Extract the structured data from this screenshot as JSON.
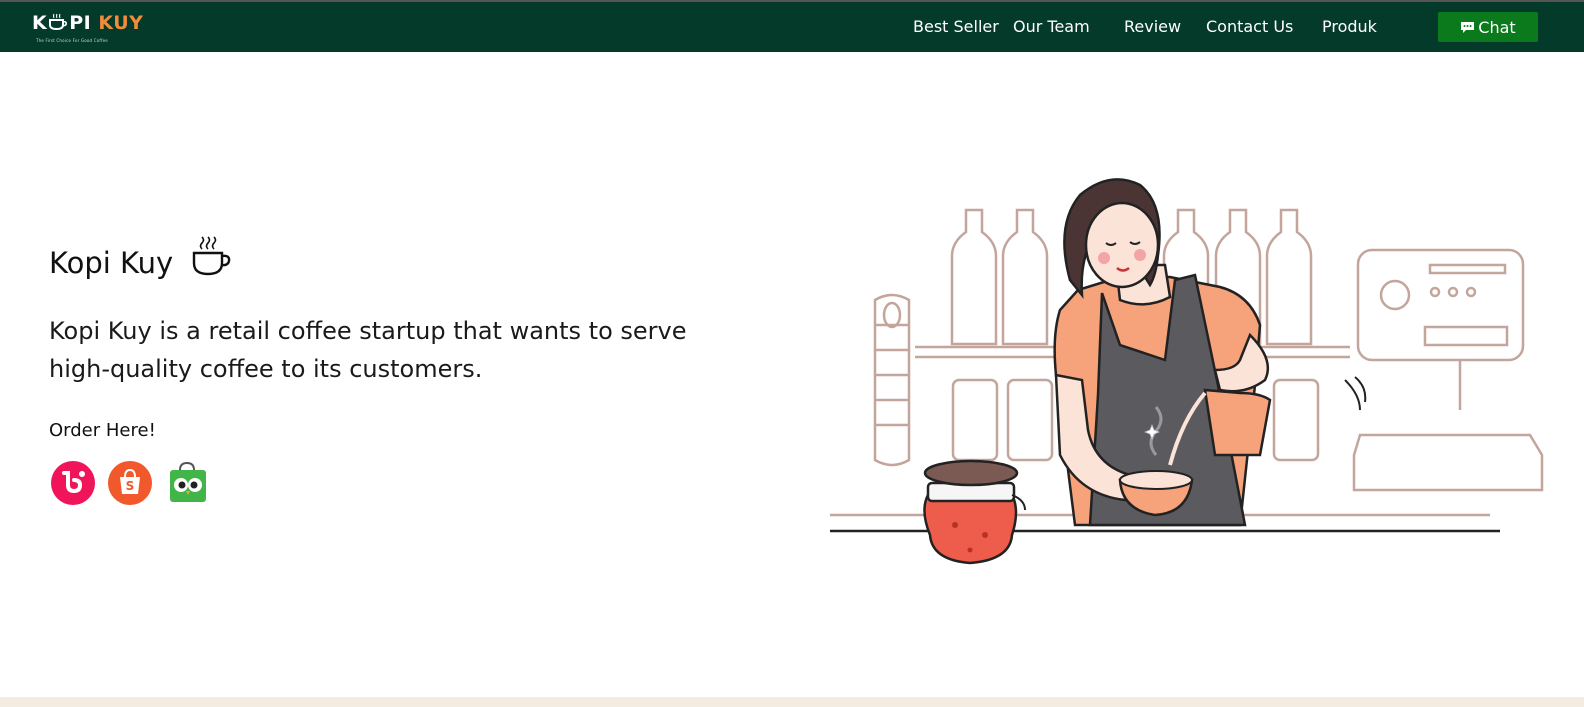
{
  "brand": {
    "logo_k": "K",
    "logo_pi": "PI",
    "logo_kuy": "KUY",
    "tagline": "The First Choice For Good Coffee",
    "colors": {
      "nav_bg": "#043a2a",
      "accent_orange": "#f08c3a",
      "chat_green": "#0a7a1c"
    }
  },
  "nav": {
    "links": [
      "Best Seller",
      "Our Team",
      "Review",
      "Contact Us",
      "Produk"
    ],
    "chat_label": "Chat",
    "chat_icon": "chat-bubble-icon"
  },
  "hero": {
    "title": "Kopi Kuy",
    "title_icon": "steaming-cup-icon",
    "description": "Kopi Kuy is a retail coffee startup that wants to serve high-quality coffee to its customers.",
    "order_label": "Order Here!",
    "stores": [
      {
        "name": "blibli",
        "icon": "blibli-logo-icon",
        "color": "#f0145a"
      },
      {
        "name": "shopee",
        "icon": "shopee-logo-icon",
        "color": "#f1582c"
      },
      {
        "name": "tokopedia",
        "icon": "tokopedia-logo-icon",
        "color": "#42b549"
      }
    ],
    "illustration": "barista-pouring-coffee-illustration"
  }
}
